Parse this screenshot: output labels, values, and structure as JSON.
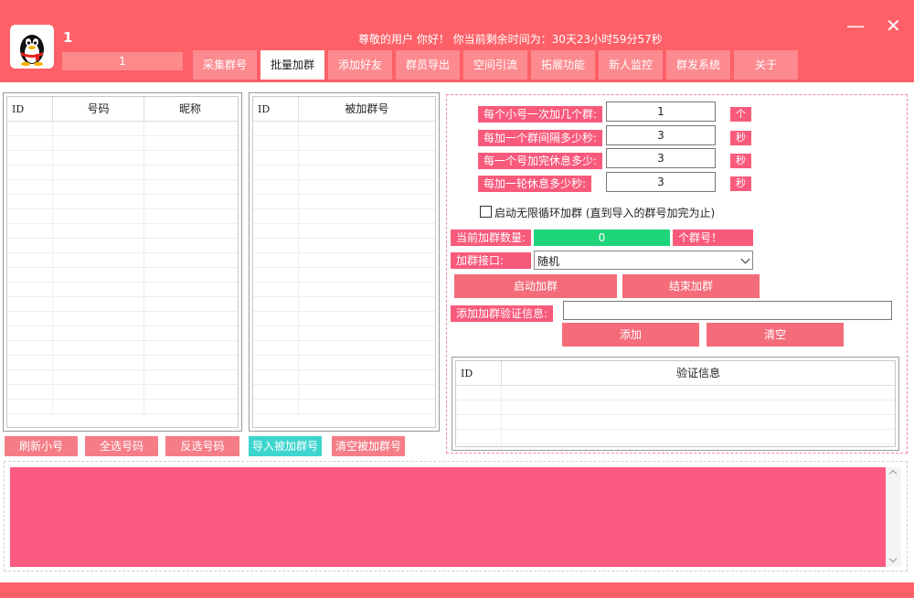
{
  "header": {
    "username": "1",
    "user_box_value": "1",
    "welcome": "尊敬的用户 你好！ 你当前剩余时间为：30天23小时59分57秒",
    "minimize": "—",
    "close": "✕"
  },
  "tabs": [
    {
      "label": "采集群号",
      "active": false
    },
    {
      "label": "批量加群",
      "active": true
    },
    {
      "label": "添加好友",
      "active": false
    },
    {
      "label": "群员导出",
      "active": false
    },
    {
      "label": "空间引流",
      "active": false
    },
    {
      "label": "拓展功能",
      "active": false
    },
    {
      "label": "新人监控",
      "active": false
    },
    {
      "label": "群发系统",
      "active": false
    },
    {
      "label": "关于",
      "active": false
    }
  ],
  "accounts_table": {
    "col_id": "ID",
    "col_number": "号码",
    "col_nickname": "昵称"
  },
  "groups_table": {
    "col_id": "ID",
    "col_group": "被加群号"
  },
  "verify_table": {
    "col_id": "ID",
    "col_info": "验证信息"
  },
  "buttons": {
    "refresh": "刷新小号",
    "select_all": "全选号码",
    "invert": "反选号码",
    "import_groups": "导入被加群号",
    "clear_groups": "清空被加群号",
    "start": "启动加群",
    "stop": "结束加群",
    "add": "添加",
    "clear": "清空"
  },
  "settings": {
    "per_account_label": "每个小号一次加几个群:",
    "per_account_value": "1",
    "per_account_unit": "个",
    "interval_label": "每加一个群间隔多少秒:",
    "interval_value": "3",
    "interval_unit": "秒",
    "rest_label": "每一个号加完休息多少:",
    "rest_value": "3",
    "rest_unit": "秒",
    "round_rest_label": "每加一轮休息多少秒:",
    "round_rest_value": "3",
    "round_rest_unit": "秒",
    "loop_label": "启动无限循环加群 (直到导入的群号加完为止)",
    "count_label": "当前加群数量:",
    "count_value": "0",
    "count_unit": "个群号！",
    "interface_label": "加群接口:",
    "interface_value": "随机",
    "verify_label": "添加加群验证信息:"
  },
  "colors": {
    "accent": "#fd6067",
    "button": "#f57d87",
    "label": "#f85a7b",
    "teal": "#3fd5cf",
    "green": "#1fd57a",
    "log": "#fd5a81"
  }
}
